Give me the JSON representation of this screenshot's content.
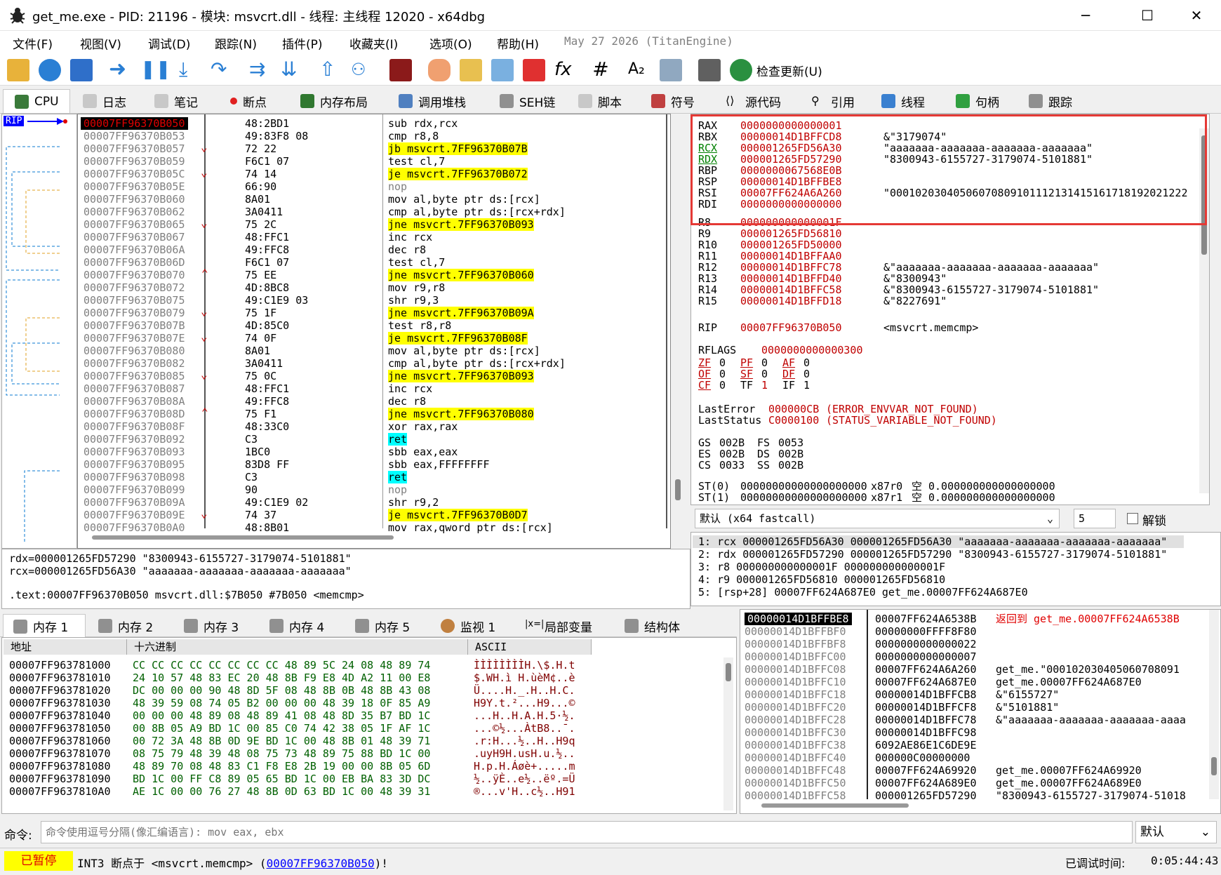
{
  "window": {
    "title": "get_me.exe - PID: 21196 - 模块: msvcrt.dll - 线程: 主线程 12020 - x64dbg",
    "minimize": "─",
    "maximize": "☐",
    "close": "✕"
  },
  "menu": [
    "文件(F)",
    "视图(V)",
    "调试(D)",
    "跟踪(N)",
    "插件(P)",
    "收藏夹(I)",
    "选项(O)",
    "帮助(H)",
    "May 27 2026 (TitanEngine)"
  ],
  "toolbar": {
    "update_label": "检查更新(U)"
  },
  "tabs": [
    "CPU",
    "日志",
    "笔记",
    "断点",
    "内存布局",
    "调用堆栈",
    "SEH链",
    "脚本",
    "符号",
    "源代码",
    "引用",
    "线程",
    "句柄",
    "跟踪"
  ],
  "disasm": {
    "rip_label": "RIP",
    "rows": [
      {
        "addr": "00007FF96370B050",
        "bytes": "48:2BD1",
        "ins": "sub rdx,rcx",
        "t": "cur"
      },
      {
        "addr": "00007FF96370B053",
        "bytes": "49:83F8 08",
        "ins": "cmp r8,8",
        "t": ""
      },
      {
        "addr": "00007FF96370B057",
        "bytes": "72 22",
        "ins": "jb msvcrt.7FF96370B07B",
        "t": "j",
        "arr": "v"
      },
      {
        "addr": "00007FF96370B059",
        "bytes": "F6C1 07",
        "ins": "test cl,7",
        "t": ""
      },
      {
        "addr": "00007FF96370B05C",
        "bytes": "74 14",
        "ins": "je msvcrt.7FF96370B072",
        "t": "j",
        "arr": "v"
      },
      {
        "addr": "00007FF96370B05E",
        "bytes": "66:90",
        "ins": "nop",
        "t": "nop"
      },
      {
        "addr": "00007FF96370B060",
        "bytes": "8A01",
        "ins": "mov al,byte ptr ds:[rcx]",
        "t": ""
      },
      {
        "addr": "00007FF96370B062",
        "bytes": "3A0411",
        "ins": "cmp al,byte ptr ds:[rcx+rdx]",
        "t": ""
      },
      {
        "addr": "00007FF96370B065",
        "bytes": "75 2C",
        "ins": "jne msvcrt.7FF96370B093",
        "t": "j",
        "arr": "v"
      },
      {
        "addr": "00007FF96370B067",
        "bytes": "48:FFC1",
        "ins": "inc rcx",
        "t": ""
      },
      {
        "addr": "00007FF96370B06A",
        "bytes": "49:FFC8",
        "ins": "dec r8",
        "t": ""
      },
      {
        "addr": "00007FF96370B06D",
        "bytes": "F6C1 07",
        "ins": "test cl,7",
        "t": ""
      },
      {
        "addr": "00007FF96370B070",
        "bytes": "75 EE",
        "ins": "jne msvcrt.7FF96370B060",
        "t": "j",
        "arr": "^"
      },
      {
        "addr": "00007FF96370B072",
        "bytes": "4D:8BC8",
        "ins": "mov r9,r8",
        "t": ""
      },
      {
        "addr": "00007FF96370B075",
        "bytes": "49:C1E9 03",
        "ins": "shr r9,3",
        "t": ""
      },
      {
        "addr": "00007FF96370B079",
        "bytes": "75 1F",
        "ins": "jne msvcrt.7FF96370B09A",
        "t": "j",
        "arr": "v"
      },
      {
        "addr": "00007FF96370B07B",
        "bytes": "4D:85C0",
        "ins": "test r8,r8",
        "t": ""
      },
      {
        "addr": "00007FF96370B07E",
        "bytes": "74 0F",
        "ins": "je msvcrt.7FF96370B08F",
        "t": "j",
        "arr": "v"
      },
      {
        "addr": "00007FF96370B080",
        "bytes": "8A01",
        "ins": "mov al,byte ptr ds:[rcx]",
        "t": ""
      },
      {
        "addr": "00007FF96370B082",
        "bytes": "3A0411",
        "ins": "cmp al,byte ptr ds:[rcx+rdx]",
        "t": ""
      },
      {
        "addr": "00007FF96370B085",
        "bytes": "75 0C",
        "ins": "jne msvcrt.7FF96370B093",
        "t": "j",
        "arr": "v"
      },
      {
        "addr": "00007FF96370B087",
        "bytes": "48:FFC1",
        "ins": "inc rcx",
        "t": ""
      },
      {
        "addr": "00007FF96370B08A",
        "bytes": "49:FFC8",
        "ins": "dec r8",
        "t": ""
      },
      {
        "addr": "00007FF96370B08D",
        "bytes": "75 F1",
        "ins": "jne msvcrt.7FF96370B080",
        "t": "j",
        "arr": "^"
      },
      {
        "addr": "00007FF96370B08F",
        "bytes": "48:33C0",
        "ins": "xor rax,rax",
        "t": ""
      },
      {
        "addr": "00007FF96370B092",
        "bytes": "C3",
        "ins": "ret",
        "t": "ret"
      },
      {
        "addr": "00007FF96370B093",
        "bytes": "1BC0",
        "ins": "sbb eax,eax",
        "t": ""
      },
      {
        "addr": "00007FF96370B095",
        "bytes": "83D8 FF",
        "ins": "sbb eax,FFFFFFFF",
        "t": ""
      },
      {
        "addr": "00007FF96370B098",
        "bytes": "C3",
        "ins": "ret",
        "t": "ret"
      },
      {
        "addr": "00007FF96370B099",
        "bytes": "90",
        "ins": "nop",
        "t": "nop"
      },
      {
        "addr": "00007FF96370B09A",
        "bytes": "49:C1E9 02",
        "ins": "shr r9,2",
        "t": ""
      },
      {
        "addr": "00007FF96370B09E",
        "bytes": "74 37",
        "ins": "je msvcrt.7FF96370B0D7",
        "t": "j",
        "arr": "v"
      },
      {
        "addr": "00007FF96370B0A0",
        "bytes": "48:8B01",
        "ins": "mov rax,qword ptr ds:[rcx]",
        "t": ""
      }
    ]
  },
  "info": [
    "rdx=000001265FD57290 \"8300943-6155727-3179074-5101881\"",
    "rcx=000001265FD56A30 \"aaaaaaa-aaaaaaa-aaaaaaa-aaaaaaa\"",
    ".text:00007FF96370B050 msvcrt.dll:$7B050 #7B050 <memcmp>"
  ],
  "registers": [
    {
      "n": "RAX",
      "v": "0000000000000001",
      "c": ""
    },
    {
      "n": "RBX",
      "v": "00000014D1BFFCD8",
      "c": "&\"3179074\""
    },
    {
      "n": "RCX",
      "v": "000001265FD56A30",
      "c": "\"aaaaaaa-aaaaaaa-aaaaaaa-aaaaaaa\""
    },
    {
      "n": "RDX",
      "v": "000001265FD57290",
      "c": "\"8300943-6155727-3179074-5101881\""
    },
    {
      "n": "RBP",
      "v": "0000000067568E0B",
      "c": ""
    },
    {
      "n": "RSP",
      "v": "00000014D1BFFBE8",
      "c": ""
    },
    {
      "n": "RSI",
      "v": "00007FF624A6A260",
      "c": "\"00010203040506070809101112131415161718192021222"
    },
    {
      "n": "RDI",
      "v": "0000000000000000",
      "c": ""
    },
    {
      "n": "R8",
      "v": "000000000000001F",
      "c": ""
    },
    {
      "n": "R9",
      "v": "000001265FD56810",
      "c": ""
    },
    {
      "n": "R10",
      "v": "000001265FD50000",
      "c": ""
    },
    {
      "n": "R11",
      "v": "00000014D1BFFAA0",
      "c": ""
    },
    {
      "n": "R12",
      "v": "00000014D1BFFC78",
      "c": "&\"aaaaaaa-aaaaaaa-aaaaaaa-aaaaaaa\""
    },
    {
      "n": "R13",
      "v": "00000014D1BFFD40",
      "c": "&\"8300943\""
    },
    {
      "n": "R14",
      "v": "00000014D1BFFC58",
      "c": "&\"8300943-6155727-3179074-5101881\""
    },
    {
      "n": "R15",
      "v": "00000014D1BFFD18",
      "c": "&\"8227691\""
    }
  ],
  "rip": {
    "n": "RIP",
    "v": "00007FF96370B050",
    "c": "<msvcrt.memcmp>"
  },
  "rflags": {
    "n": "RFLAGS",
    "v": "0000000000000300"
  },
  "flags": [
    [
      "ZF",
      "0",
      "PF",
      "0",
      "AF",
      "0"
    ],
    [
      "OF",
      "0",
      "SF",
      "0",
      "DF",
      "0"
    ],
    [
      "CF",
      "0",
      "TF",
      "1",
      "IF",
      "1"
    ]
  ],
  "lasterror": {
    "n": "LastError",
    "v": "000000CB",
    "c": "(ERROR_ENVVAR_NOT_FOUND)"
  },
  "laststatus": {
    "n": "LastStatus",
    "v": "C0000100",
    "c": "(STATUS_VARIABLE_NOT_FOUND)"
  },
  "segs": [
    [
      "GS",
      "002B",
      "FS",
      "0053"
    ],
    [
      "ES",
      "002B",
      "DS",
      "002B"
    ],
    [
      "CS",
      "0033",
      "SS",
      "002B"
    ]
  ],
  "fpu": [
    {
      "n": "ST(0)",
      "v": "00000000000000000000",
      "t": "x87r0",
      "s": "空",
      "f": "0.000000000000000000"
    },
    {
      "n": "ST(1)",
      "v": "00000000000000000000",
      "t": "x87r1",
      "s": "空",
      "f": "0.000000000000000000"
    }
  ],
  "callconv": {
    "selected": "默认 (x64 fastcall)",
    "count": "5",
    "unlock": "解锁"
  },
  "callargs": [
    "1: rcx 000001265FD56A30 000001265FD56A30 \"aaaaaaa-aaaaaaa-aaaaaaa-aaaaaaa\"",
    "2: rdx 000001265FD57290 000001265FD57290 \"8300943-6155727-3179074-5101881\"",
    "3: r8 000000000000001F 000000000000001F",
    "4: r9 000001265FD56810 000001265FD56810",
    "5: [rsp+28] 00007FF624A687E0 get_me.00007FF624A687E0"
  ],
  "bottom_tabs": [
    "内存 1",
    "内存 2",
    "内存 3",
    "内存 4",
    "内存 5",
    "监视 1",
    "局部变量",
    "结构体"
  ],
  "dump": {
    "headers": [
      "地址",
      "十六进制",
      "ASCII"
    ],
    "rows": [
      {
        "a": "00007FF963781000",
        "h": "CC CC CC CC CC CC CC CC 48 89 5C 24 08 48 89 74",
        "s": "ÌÌÌÌÌÌÌÌH.\\$.H.t"
      },
      {
        "a": "00007FF963781010",
        "h": "24 10 57 48 83 EC 20 48 8B F9 E8 4D A2 11 00 E8",
        "s": "$.WH.ì H.ùèM¢..è"
      },
      {
        "a": "00007FF963781020",
        "h": "DC 00 00 00 90 48 8D 5F 08 48 8B 0B 48 8B 43 08",
        "s": "Ü....H._.H..H.C."
      },
      {
        "a": "00007FF963781030",
        "h": "48 39 59 08 74 05 B2 00 00 00 48 39 18 0F 85 A9",
        "s": "H9Y.t.²...H9...©"
      },
      {
        "a": "00007FF963781040",
        "h": "00 00 00 48 89 08 48 89 41 08 48 8D 35 B7 BD 1C",
        "s": "...H..H.A.H.5·½."
      },
      {
        "a": "00007FF963781050",
        "h": "00 8B 05 A9 BD 1C 00 85 C0 74 42 38 05 1F AF 1C",
        "s": "...©½...ÀtB8..¯."
      },
      {
        "a": "00007FF963781060",
        "h": "00 72 3A 48 8B 0D 9E BD 1C 00 48 8B 01 48 39 71",
        "s": ".r:H...½..H..H9q"
      },
      {
        "a": "00007FF963781070",
        "h": "08 75 79 48 39 48 08 75 73 48 89 75 88 BD 1C 00",
        "s": ".uyH9H.usH.u.½.."
      },
      {
        "a": "00007FF963781080",
        "h": "48 89 70 08 48 83 C1 F8 E8 2B 19 00 00 8B 05 6D",
        "s": "H.p.H.Áøè+.....m"
      },
      {
        "a": "00007FF963781090",
        "h": "BD 1C 00 FF C8 89 05 65 BD 1C 00 EB BA 83 3D DC",
        "s": "½..ÿÈ..e½..ëº.=Ü"
      },
      {
        "a": "00007FF9637810A0",
        "h": "AE 1C 00 00 76 27 48 8B 0D 63 BD 1C 00 48 39 31",
        "s": "®...v'H..c½..H91"
      }
    ]
  },
  "stack": [
    {
      "a": "00000014D1BFFBE8",
      "v": "00007FF624A6538B",
      "c": "返回到 get_me.00007FF624A6538B"
    },
    {
      "a": "00000014D1BFFBF0",
      "v": "00000000FFFF8F80",
      "c": ""
    },
    {
      "a": "00000014D1BFFBF8",
      "v": "0000000000000022",
      "c": ""
    },
    {
      "a": "00000014D1BFFC00",
      "v": "0000000000000007",
      "c": ""
    },
    {
      "a": "00000014D1BFFC08",
      "v": "00007FF624A6A260",
      "c": "get_me.\"000102030405060708091"
    },
    {
      "a": "00000014D1BFFC10",
      "v": "00007FF624A687E0",
      "c": "get_me.00007FF624A687E0"
    },
    {
      "a": "00000014D1BFFC18",
      "v": "00000014D1BFFCB8",
      "c": "&\"6155727\""
    },
    {
      "a": "00000014D1BFFC20",
      "v": "00000014D1BFFCF8",
      "c": "&\"5101881\""
    },
    {
      "a": "00000014D1BFFC28",
      "v": "00000014D1BFFC78",
      "c": "&\"aaaaaaa-aaaaaaa-aaaaaaa-aaaa"
    },
    {
      "a": "00000014D1BFFC30",
      "v": "00000014D1BFFC98",
      "c": ""
    },
    {
      "a": "00000014D1BFFC38",
      "v": "6092AE86E1C6DE9E",
      "c": ""
    },
    {
      "a": "00000014D1BFFC40",
      "v": "000000C00000000",
      "c": ""
    },
    {
      "a": "00000014D1BFFC48",
      "v": "00007FF624A69920",
      "c": "get_me.00007FF624A69920"
    },
    {
      "a": "00000014D1BFFC50",
      "v": "00007FF624A689E0",
      "c": "get_me.00007FF624A689E0"
    },
    {
      "a": "00000014D1BFFC58",
      "v": "000001265FD57290",
      "c": "\"8300943-6155727-3179074-51018"
    }
  ],
  "command": {
    "label": "命令:",
    "placeholder": "命令使用逗号分隔(像汇编语言): mov eax, ebx",
    "mode": "默认"
  },
  "status": {
    "state": "已暂停",
    "msg_prefix": "INT3  断点于 <msvcrt.memcmp> (",
    "link": "00007FF96370B050",
    "msg_suffix": ")!",
    "time_label": "已调试时间:",
    "time": "0:05:44:43"
  },
  "colors": {
    "accent": "#0000ff",
    "highlight": "#ffff00",
    "ret": "#00ffff",
    "paused": "#ffff00",
    "redbox": "#e53935"
  }
}
